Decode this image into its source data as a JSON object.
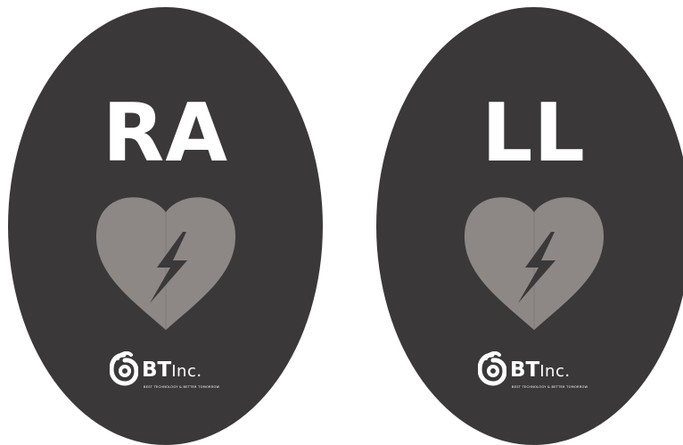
{
  "pads": [
    {
      "label": "RA",
      "icon": "heart-lightning-icon",
      "brand": {
        "name_bold": "BT",
        "name_light": "Inc.",
        "tagline": "BEST TECHNOLOGY & BETTER TOMORROW"
      }
    },
    {
      "label": "LL",
      "icon": "heart-lightning-icon",
      "brand": {
        "name_bold": "BT",
        "name_light": "Inc.",
        "tagline": "BEST TECHNOLOGY & BETTER TOMORROW"
      }
    }
  ],
  "colors": {
    "pad_background": "#3b3839",
    "heart_fill": "#8d8886",
    "text": "#ffffff"
  }
}
